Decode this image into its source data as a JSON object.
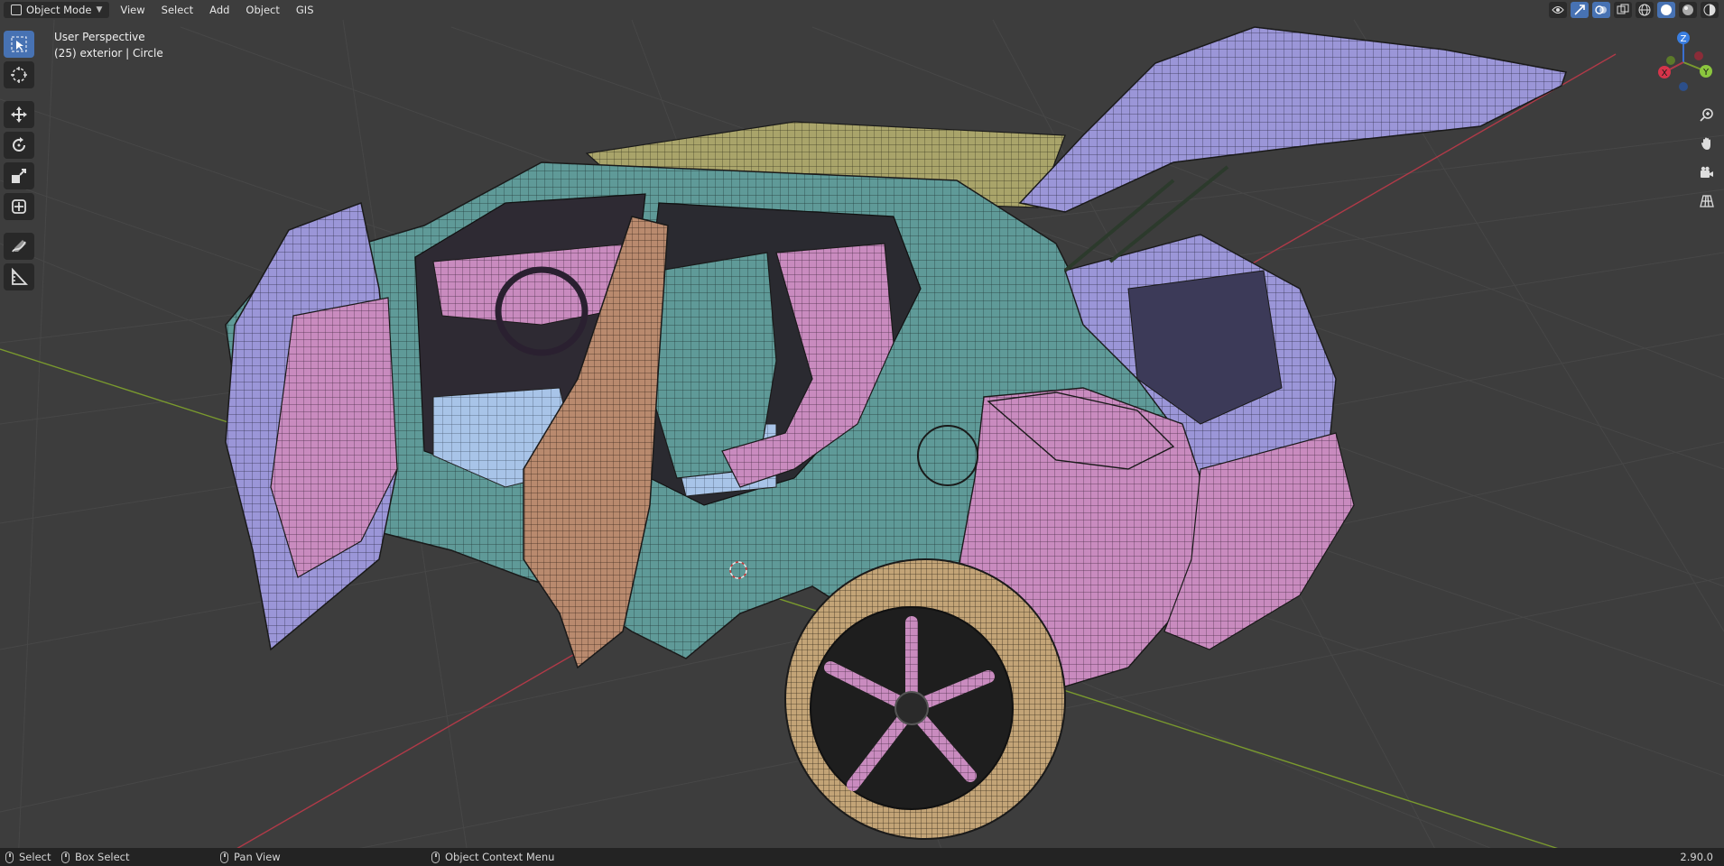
{
  "header": {
    "mode_label": "Object Mode",
    "menu": [
      "View",
      "Select",
      "Add",
      "Object",
      "GIS"
    ]
  },
  "viewport_info": {
    "view_name": "User Perspective",
    "object_line": "(25) exterior  | Circle"
  },
  "toolbar": {
    "tools": [
      "select-box-icon",
      "cursor-icon",
      "move-icon",
      "rotate-icon",
      "scale-icon",
      "transform-icon",
      "annotate-icon",
      "measure-icon"
    ],
    "active": "select-box-icon"
  },
  "gizmo": {
    "x": "X",
    "y": "Y",
    "z": "Z"
  },
  "statusbar": {
    "select": "Select",
    "box_select": "Box Select",
    "pan_view": "Pan View",
    "context_menu": "Object Context Menu",
    "version": "2.90.0"
  },
  "colors": {
    "background": "#3d3d3d",
    "grid": "#474747",
    "x_axis": "#b03a48",
    "y_axis": "#7a9a2e",
    "active": "#4772b3",
    "body_teal": "#5f9a98",
    "panel_pink": "#c98bbf",
    "panel_violet": "#9b96d8",
    "tire_tan": "#c3a477"
  }
}
